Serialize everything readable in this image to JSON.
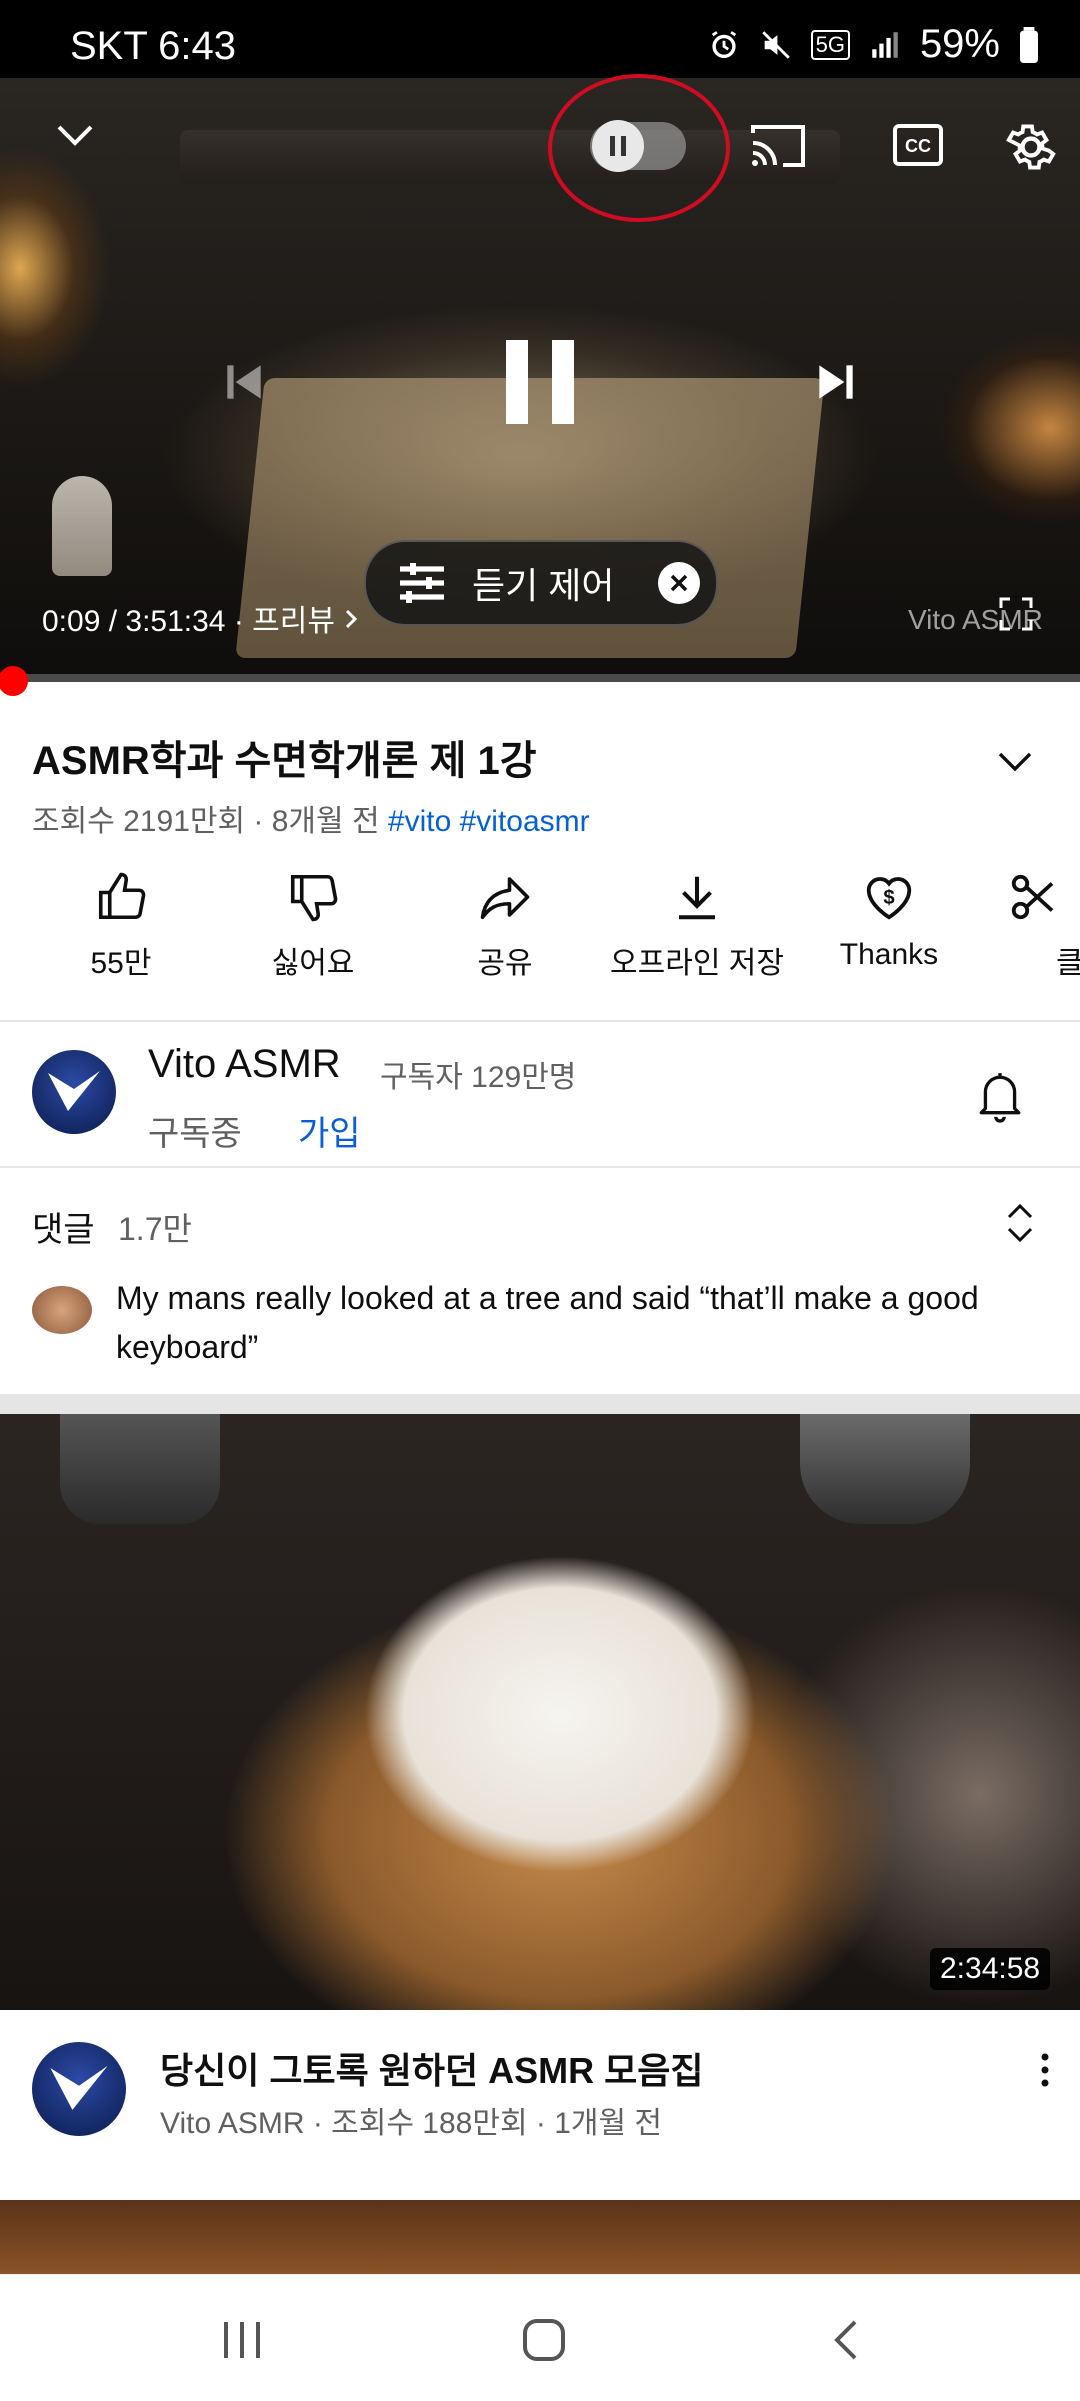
{
  "status_bar": {
    "carrier_time": "SKT 6:43",
    "battery": "59%",
    "network": "5G"
  },
  "player": {
    "time_text": "0:09 / 3:51:34 · 프리뷰",
    "listen_control_label": "듣기 제어",
    "watermark": "Vito ASMR",
    "progress": 0.01
  },
  "video": {
    "title": "ASMR학과 수면학개론 제 1강",
    "meta": "조회수 2191만회 · 8개월 전",
    "hashtags": [
      "#vito",
      "#vitoasmr"
    ]
  },
  "actions": {
    "like": "55만",
    "dislike": "싫어요",
    "share": "공유",
    "download": "오프라인 저장",
    "thanks": "Thanks",
    "clip": "클"
  },
  "channel": {
    "name": "Vito ASMR",
    "subscribers": "구독자 129만명",
    "subscribed_label": "구독중",
    "join_label": "가입"
  },
  "comments": {
    "label": "댓글",
    "count": "1.7만",
    "top_comment": "My mans really looked at a tree and said “that’ll make a good keyboard”"
  },
  "recommended": {
    "duration": "2:34:58",
    "title": "당신이 그토록 원하던 ASMR 모음집",
    "meta": "Vito ASMR · 조회수 188만회 · 1개월 전"
  },
  "colors": {
    "accent_red": "#ff0000",
    "link_blue": "#065fd4",
    "annotation_red": "#d10c22"
  }
}
